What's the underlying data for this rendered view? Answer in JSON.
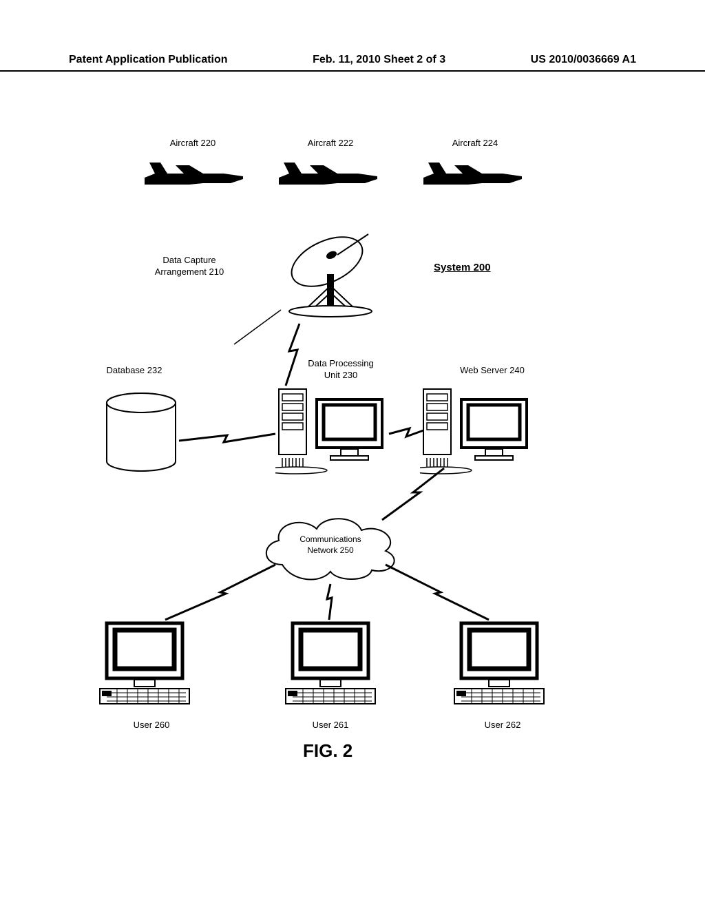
{
  "header": {
    "left": "Patent Application Publication",
    "center": "Feb. 11, 2010  Sheet 2 of 3",
    "right": "US 2010/0036669 A1"
  },
  "labels": {
    "aircraft220": "Aircraft 220",
    "aircraft222": "Aircraft 222",
    "aircraft224": "Aircraft 224",
    "dataCapture": "Data Capture\nArrangement 210",
    "system": "System 200",
    "database": "Database 232",
    "dpu": "Data Processing\nUnit 230",
    "webserver": "Web Server 240",
    "network": "Communications\nNetwork 250",
    "user260": "User 260",
    "user261": "User 261",
    "user262": "User 262",
    "figcaption": "FIG. 2"
  }
}
